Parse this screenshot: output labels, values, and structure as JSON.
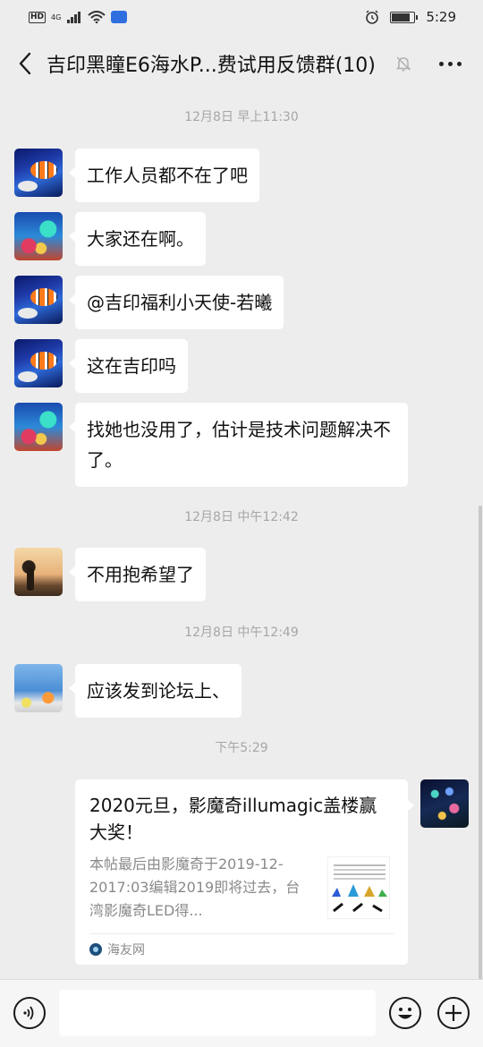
{
  "status_bar": {
    "hd": "HD",
    "network": "4G",
    "time": "5:29",
    "battery_level_percent": 80
  },
  "chat": {
    "title": "吉印黑瞳E6海水P...费试用反馈群(10)"
  },
  "timestamps": [
    "12月8日 早上11:30",
    "12月8日 中午12:42",
    "12月8日 中午12:49",
    "下午5:29"
  ],
  "messages": [
    {
      "text": "工作人员都不在了吧",
      "avatar": "clownfish-avatar"
    },
    {
      "text": "大家还在啊。",
      "avatar": "reef-avatar"
    },
    {
      "text": "@吉印福利小天使-若曦",
      "avatar": "clownfish-avatar"
    },
    {
      "text": "这在吉印吗",
      "avatar": "clownfish-avatar"
    },
    {
      "text": "找她也没用了，估计是技术问题解决不了。",
      "avatar": "reef-avatar"
    },
    {
      "text": "不用抱希望了",
      "avatar": "sunset-avatar"
    },
    {
      "text": "应该发到论坛上、",
      "avatar": "aquarium-avatar"
    }
  ],
  "link_card": {
    "title": "2020元旦，影魔奇illumagic盖楼赢大奖！",
    "description": "本帖最后由影魔奇于2019-12-2017:03编辑2019即将过去，台湾影魔奇LED得...",
    "source": "海友网"
  },
  "icons": {
    "back": "chevron-left-icon",
    "mute": "bell-off-icon",
    "more": "more-icon",
    "voice": "voice-icon",
    "emoji": "emoji-icon",
    "plus": "plus-icon"
  }
}
